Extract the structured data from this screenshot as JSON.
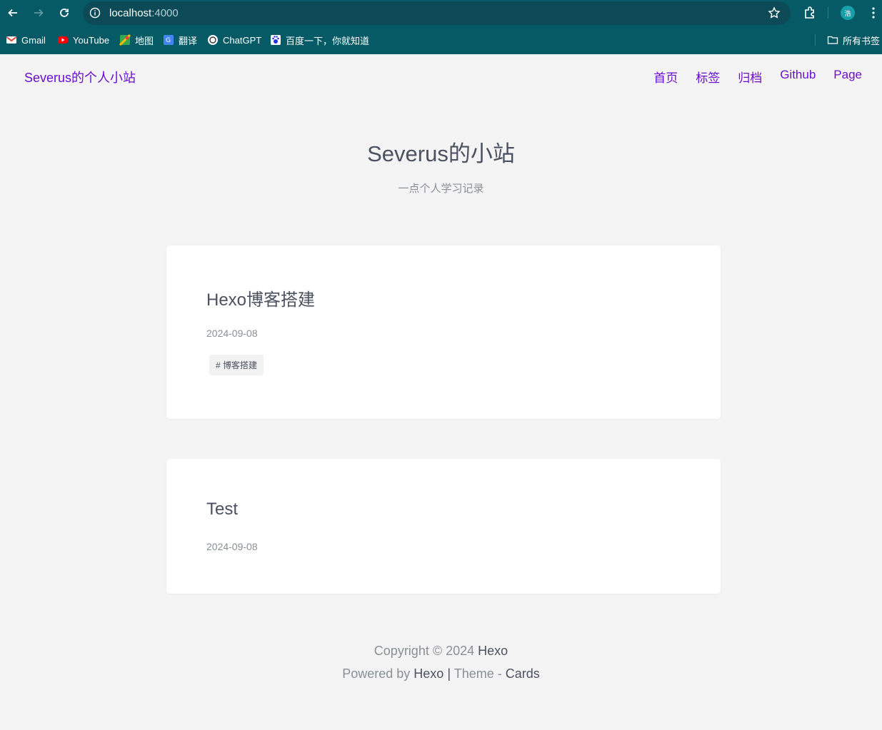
{
  "browser": {
    "url_host": "localhost",
    "url_port": ":4000",
    "avatar_text": "浩",
    "bookmarks": [
      {
        "label": "Gmail",
        "icon": "gmail-icon",
        "color": "#ea4335"
      },
      {
        "label": "YouTube",
        "icon": "youtube-icon",
        "color": "#ff0000"
      },
      {
        "label": "地图",
        "icon": "maps-icon",
        "color": "#34a853"
      },
      {
        "label": "翻译",
        "icon": "translate-icon",
        "color": "#4285f4"
      },
      {
        "label": "ChatGPT",
        "icon": "chatgpt-icon",
        "color": "#ffffff"
      },
      {
        "label": "百度一下，你就知道",
        "icon": "baidu-icon",
        "color": "#2932e1"
      }
    ],
    "all_bookmarks_label": "所有书签"
  },
  "site": {
    "logo": "Severus的个人小站",
    "nav": [
      "首页",
      "标签",
      "归档",
      "Github",
      "Page"
    ],
    "title": "Severus的小站",
    "subtitle": "一点个人学习记录",
    "accent_color": "#6a0dd0"
  },
  "posts": [
    {
      "title": "Hexo博客搭建",
      "date": "2024-09-08",
      "tag": "# 博客搭建"
    },
    {
      "title": "Test",
      "date": "2024-09-08"
    }
  ],
  "footer": {
    "copyright_prefix": "Copyright © 2024",
    "copyright_name": "Hexo",
    "powered_prefix": "Powered by",
    "powered_link": "Hexo",
    "divider": "|",
    "theme_prefix": "Theme -",
    "theme_link": "Cards"
  }
}
